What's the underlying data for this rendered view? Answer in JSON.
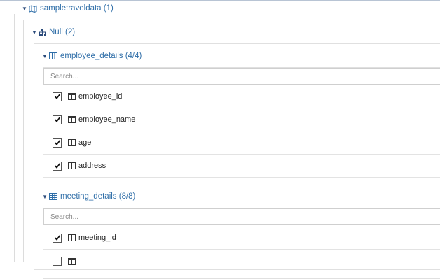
{
  "database": {
    "label": "sampletraveldata (1)",
    "icon": "map-icon"
  },
  "schema": {
    "label": "Null (2)",
    "icon": "sitemap-icon"
  },
  "tables": [
    {
      "label": "employee_details (4/4)",
      "icon": "table-icon",
      "search_placeholder": "Search...",
      "columns": [
        {
          "name": "employee_id",
          "checked": true
        },
        {
          "name": "employee_name",
          "checked": true
        },
        {
          "name": "age",
          "checked": true
        },
        {
          "name": "address",
          "checked": true
        }
      ]
    },
    {
      "label": "meeting_details (8/8)",
      "icon": "table-icon",
      "search_placeholder": "Search...",
      "columns": [
        {
          "name": "meeting_id",
          "checked": true
        },
        {
          "name": "",
          "checked": false
        }
      ]
    }
  ],
  "colors": {
    "link": "#2f6ea8",
    "border": "#e0e0e0"
  }
}
